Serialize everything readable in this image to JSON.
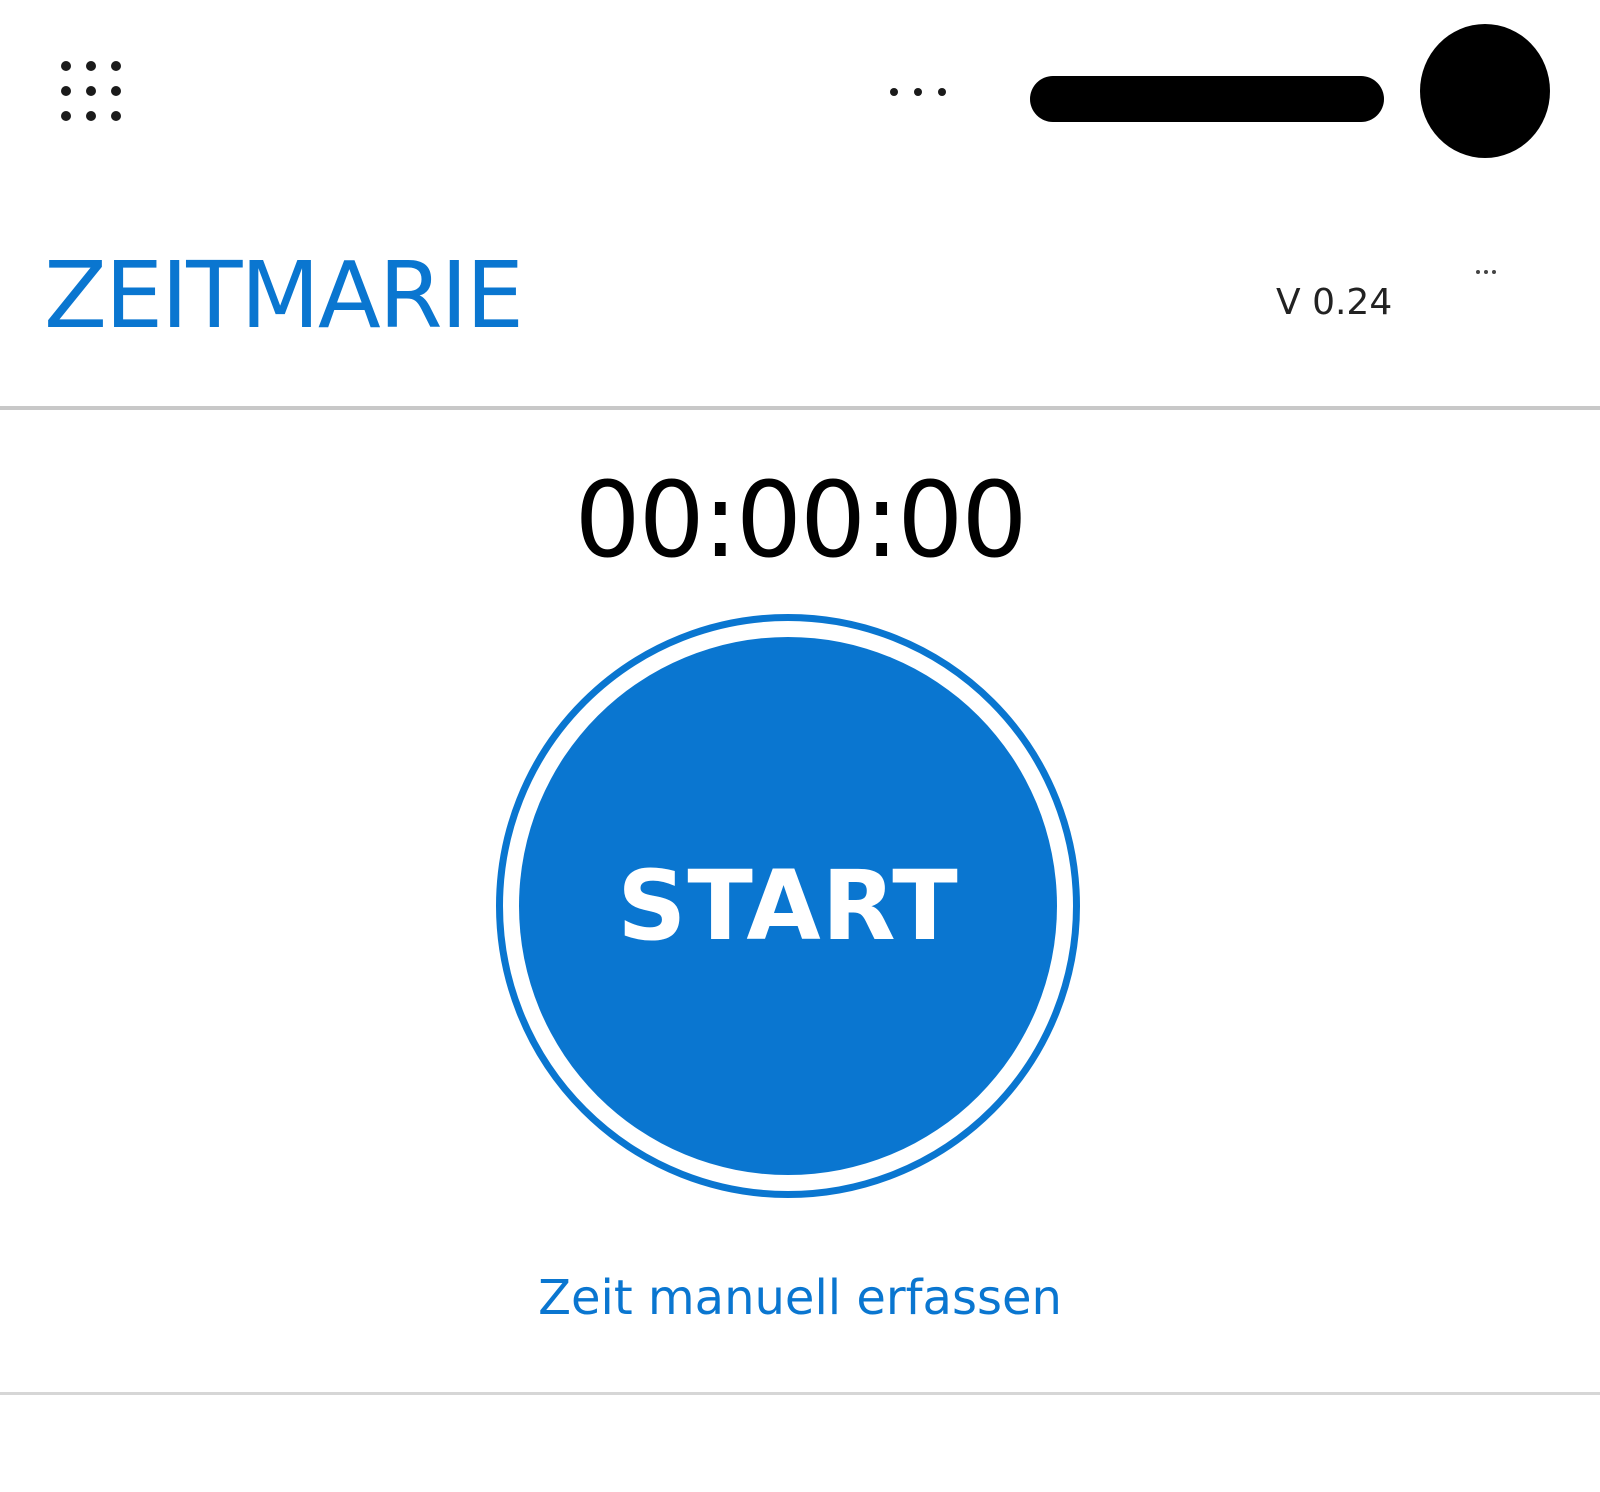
{
  "app": {
    "title": "ZEITMARIE",
    "version": "V 0.24"
  },
  "timer": {
    "display": "00:00:00"
  },
  "actions": {
    "start_label": "START",
    "manual_entry_label": "Zeit manuell erfassen"
  },
  "icons": {
    "waffle": "app-launcher-icon",
    "top_more": "more-horizontal-icon",
    "header_more": "more-horizontal-icon"
  },
  "colors": {
    "accent": "#0a76d0",
    "text": "#000000",
    "divider": "#c8c8c8"
  }
}
